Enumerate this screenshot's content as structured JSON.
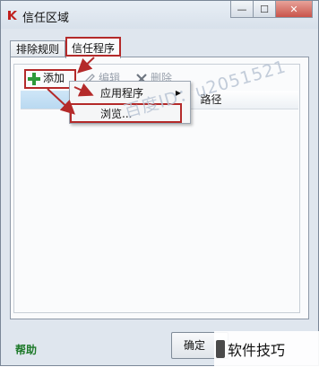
{
  "window": {
    "title": "信任区域"
  },
  "window_controls": {
    "minimize": "—",
    "maximize": "☐",
    "close": "✕"
  },
  "tabs": [
    {
      "label": "排除规则"
    },
    {
      "label": "信任程序"
    }
  ],
  "toolbar": {
    "add_label": "添加",
    "edit_label": "编辑",
    "delete_label": "删除"
  },
  "list": {
    "path_header": "路径"
  },
  "context_menu": {
    "items": [
      {
        "label": "应用程序"
      },
      {
        "label": "浏览..."
      }
    ]
  },
  "watermark": "百度ID：u2051521",
  "footer": {
    "help_label": "帮助",
    "ok_label": "确定",
    "corner_watermark": "软件技巧"
  },
  "colors": {
    "highlight": "#b42a2a",
    "add_icon": "#2e9a3a",
    "help_link": "#1e7a2a"
  }
}
